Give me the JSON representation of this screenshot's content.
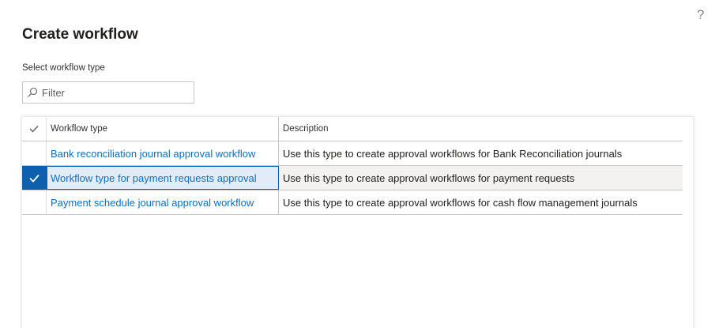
{
  "help": {
    "icon": "help-icon",
    "glyph": "?"
  },
  "page": {
    "title": "Create workflow"
  },
  "selector": {
    "label": "Select workflow type",
    "filter_placeholder": "Filter",
    "filter_value": ""
  },
  "grid": {
    "columns": {
      "check": "check-mark-icon",
      "type": "Workflow type",
      "description": "Description"
    },
    "rows": [
      {
        "type": "Bank reconciliation journal approval workflow",
        "description": "Use this type to create approval workflows for Bank Reconciliation journals",
        "selected": false
      },
      {
        "type": "Workflow type for payment requests approval",
        "description": "Use this type to create approval workflows for payment requests",
        "selected": true
      },
      {
        "type": "Payment schedule journal approval workflow",
        "description": "Use this type to create approval workflows for cash flow management journals",
        "selected": false
      }
    ]
  },
  "colors": {
    "accent": "#0f5faf",
    "link": "#106ebe",
    "selected_row": "#f3f2f1"
  }
}
